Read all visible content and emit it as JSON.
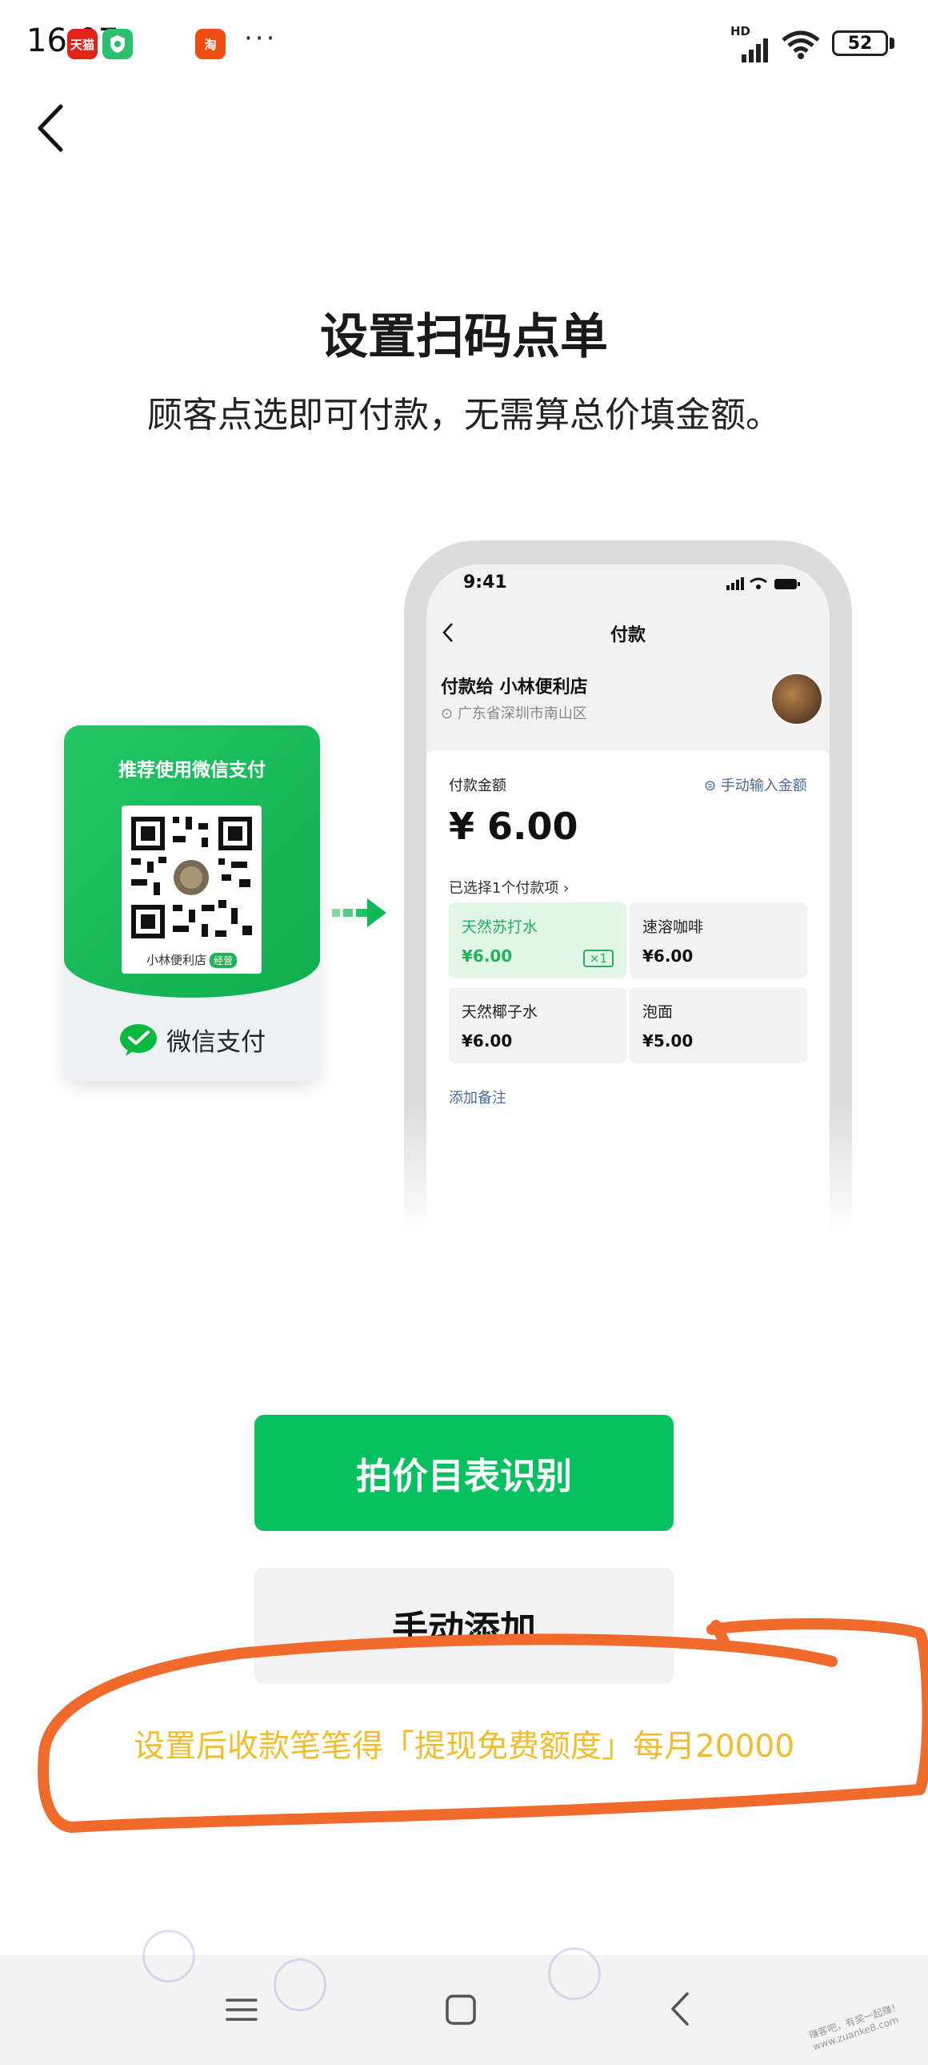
{
  "status_bar": {
    "time": "16:07",
    "apps": [
      {
        "name": "tmall-app-icon",
        "label": "天猫",
        "color": "#e2231a"
      },
      {
        "name": "shield-app-icon",
        "label": "",
        "color": "#2bbf6f"
      },
      {
        "name": "taobao-app-icon",
        "label": "淘",
        "color": "#f04d12"
      }
    ],
    "more": "···",
    "network": "HD",
    "battery": "52"
  },
  "page": {
    "title": "设置扫码点单",
    "subtitle": "顾客点选即可付款，无需算总价填金额。"
  },
  "qr_stand": {
    "header": "推荐使用微信支付",
    "shop_name": "小林便利店",
    "shop_badge": "经营",
    "brand": "微信支付"
  },
  "phone_preview": {
    "time": "9:41",
    "title": "付款",
    "payee": "付款给 小林便利店",
    "address": "广东省深圳市南山区",
    "amount_label": "付款金额",
    "manual_amount": "手动输入金额",
    "amount": "¥ 6.00",
    "selected_summary": "已选择1个付款项 ›",
    "items": [
      {
        "name": "天然苏打水",
        "price": "¥6.00",
        "selected": true,
        "qty": "×1"
      },
      {
        "name": "速溶咖啡",
        "price": "¥6.00",
        "selected": false
      },
      {
        "name": "天然椰子水",
        "price": "¥6.00",
        "selected": false
      },
      {
        "name": "泡面",
        "price": "¥5.00",
        "selected": false
      }
    ],
    "add_note": "添加备注"
  },
  "actions": {
    "primary": "拍价目表识别",
    "secondary": "手动添加"
  },
  "hint": "设置后收款笔笔得「提现免费额度」每月20000",
  "watermark": "赚客吧，有奖一起赚！www.zuanke8.com",
  "colors": {
    "wechat_green": "#07c160",
    "hint_yellow": "#f3bc2b",
    "annotation_orange": "#f06a2c"
  }
}
